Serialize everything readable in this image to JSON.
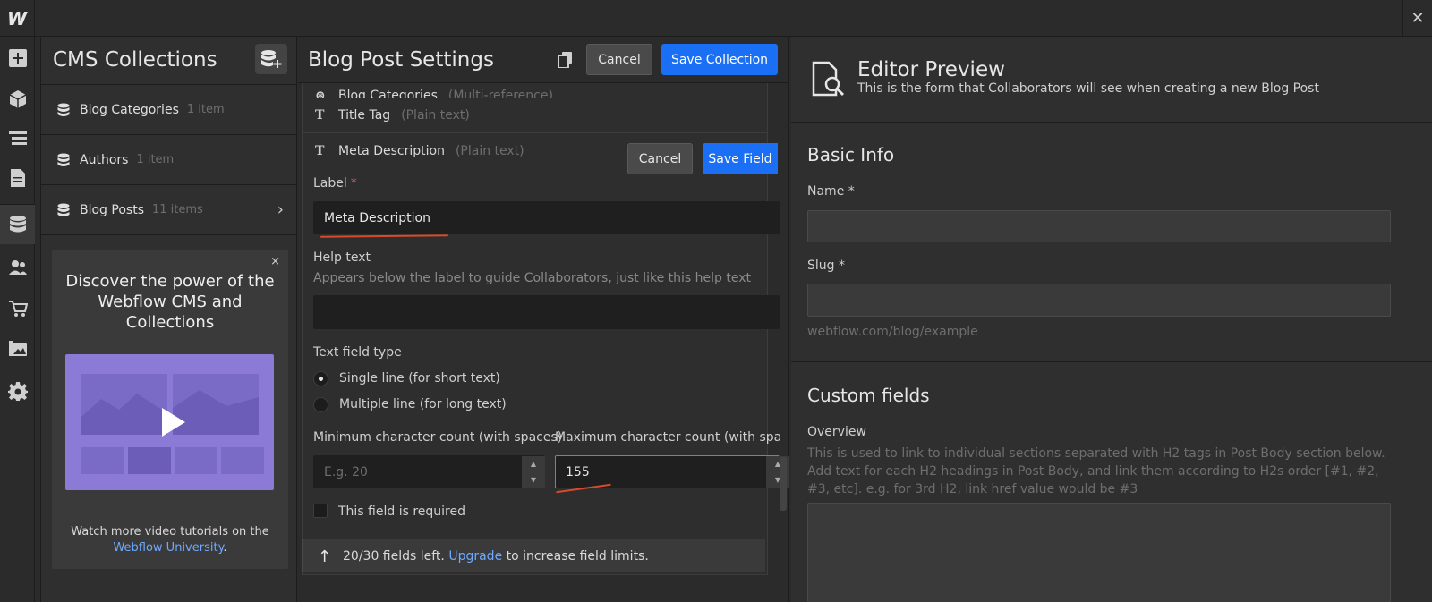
{
  "topbar": {
    "logo": "W",
    "close": "✕"
  },
  "cms": {
    "title": "CMS Collections",
    "items": [
      {
        "name": "Blog Categories",
        "count": "1 item"
      },
      {
        "name": "Authors",
        "count": "1 item"
      },
      {
        "name": "Blog Posts",
        "count": "11 items"
      }
    ],
    "promo": {
      "close": "×",
      "title": "Discover the power of the Webflow CMS and Collections",
      "text_prefix": "Watch more video tutorials on the",
      "link": "Webflow University",
      "text_suffix": "."
    }
  },
  "settings": {
    "title": "Blog Post Settings",
    "cancel": "Cancel",
    "save_collection": "Save Collection",
    "partial_field": {
      "name": "Blog Categories",
      "type": "(Multi-reference)"
    },
    "fields": [
      {
        "name": "Title Tag",
        "type": "(Plain text)"
      },
      {
        "name": "Meta Description",
        "type": "(Plain text)"
      }
    ],
    "field_cancel": "Cancel",
    "save_field": "Save Field",
    "label_label": "Label",
    "required_marker": "*",
    "label_value": "Meta Description",
    "help_label": "Help text",
    "help_desc": "Appears below the label to guide Collaborators, just like this help text",
    "help_value": "",
    "type_label": "Text field type",
    "type_options": [
      "Single line (for short text)",
      "Multiple line (for long text)"
    ],
    "type_selected": "Single line (for short text)",
    "min_label": "Minimum character count (with spaces)",
    "min_placeholder": "E.g. 20",
    "max_label": "Maximum character count (with spaces)",
    "max_value": "155",
    "required_label": "This field is required",
    "limits_count": "20/30 fields left.",
    "limits_link": "Upgrade",
    "limits_suffix": "to increase field limits."
  },
  "preview": {
    "title": "Editor Preview",
    "subtitle": "This is the form that Collaborators will see when creating a new Blog Post",
    "basic_title": "Basic Info",
    "name_label": "Name *",
    "slug_label": "Slug *",
    "slug_hint": "webflow.com/blog/example",
    "custom_title": "Custom fields",
    "overview_label": "Overview",
    "overview_help": "This is used to link to individual sections separated with H2 tags in Post Body section below. Add text for each H2 headings in Post Body, and link them according to H2s order [#1, #2, #3, etc]. e.g. for 3rd H2, link href value would be #3"
  },
  "colors": {
    "accent": "#1a6ff5",
    "link": "#6ea8ff",
    "required": "#ff4d4d",
    "annotation": "#d84a2b",
    "promo": "#8b7bd6"
  }
}
